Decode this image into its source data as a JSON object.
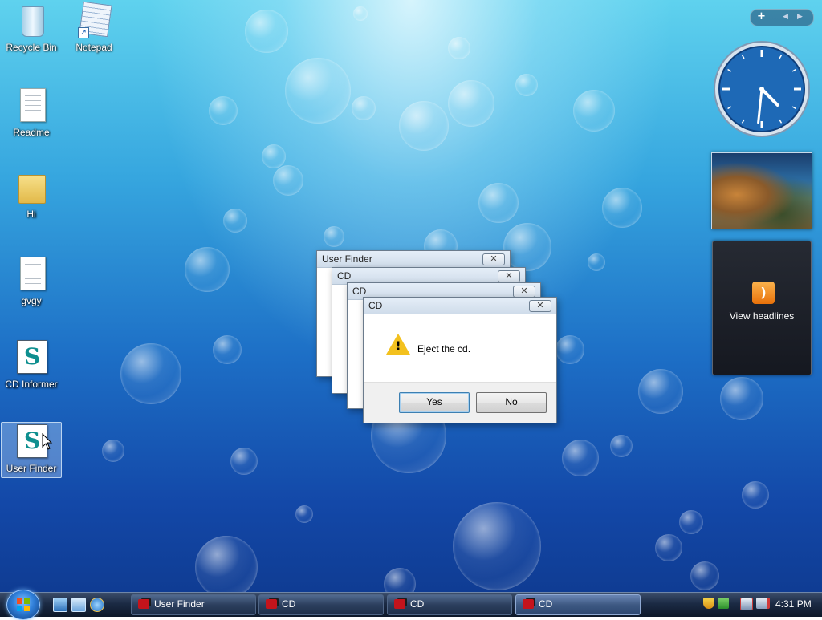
{
  "desktop": {
    "icons": [
      {
        "label": "Recycle Bin",
        "icon": "recycle-bin-icon"
      },
      {
        "label": "Notepad",
        "icon": "notepad-icon"
      },
      {
        "label": "Readme",
        "icon": "text-document-icon"
      },
      {
        "label": "Hi",
        "icon": "folder-icon"
      },
      {
        "label": "gvgy",
        "icon": "text-document-icon"
      },
      {
        "label": "CD Informer",
        "icon": "script-icon"
      },
      {
        "label": "User Finder",
        "icon": "script-icon"
      }
    ]
  },
  "sidebar": {
    "toolbar": {
      "add": "+",
      "prev": "◀",
      "next": "▶"
    },
    "clock": {
      "hour": 4,
      "minute": 31
    },
    "feed_headlines": {
      "label": "View headlines",
      "icon": "rss-icon"
    }
  },
  "dialogs": [
    {
      "title": "User Finder"
    },
    {
      "title": "CD"
    },
    {
      "title": "CD"
    },
    {
      "title": "CD",
      "message": "Eject the cd.",
      "yes_label": "Yes",
      "no_label": "No"
    }
  ],
  "close_glyph": "✕",
  "taskbar": {
    "buttons": [
      {
        "label": "User Finder",
        "active": false
      },
      {
        "label": "CD",
        "active": false
      },
      {
        "label": "CD",
        "active": false
      },
      {
        "label": "CD",
        "active": true
      }
    ],
    "clock_text": "4:31 PM"
  },
  "colors": {
    "desktop_top": "#5fd2ee",
    "desktop_bottom": "#0f3c93",
    "warning": "#f3c11e",
    "rss": "#e8710a"
  }
}
